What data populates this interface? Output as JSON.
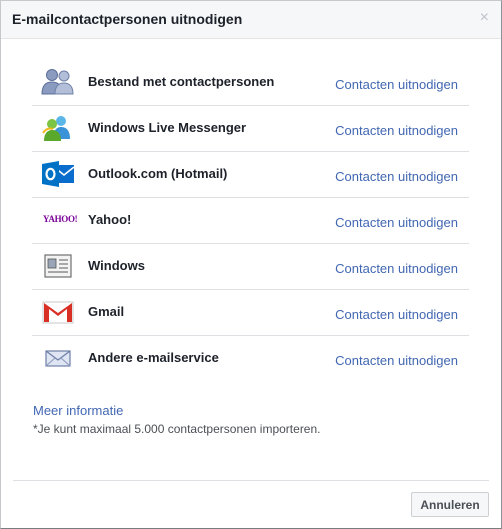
{
  "dialog": {
    "title": "E-mailcontactpersonen uitnodigen",
    "close_glyph": "×"
  },
  "providers": [
    {
      "name": "Bestand met contactpersonen",
      "icon": "contacts-file-icon",
      "action": "Contacten uitnodigen"
    },
    {
      "name": "Windows Live Messenger",
      "icon": "windows-live-messenger-icon",
      "action": "Contacten uitnodigen"
    },
    {
      "name": "Outlook.com (Hotmail)",
      "icon": "outlook-icon",
      "action": "Contacten uitnodigen"
    },
    {
      "name": "Yahoo!",
      "icon": "yahoo-icon",
      "logo_text": "YAHOO!",
      "action": "Contacten uitnodigen"
    },
    {
      "name": "Windows",
      "icon": "windows-address-book-icon",
      "action": "Contacten uitnodigen"
    },
    {
      "name": "Gmail",
      "icon": "gmail-icon",
      "action": "Contacten uitnodigen"
    },
    {
      "name": "Andere e-mailservice",
      "icon": "envelope-icon",
      "action": "Contacten uitnodigen"
    }
  ],
  "info": {
    "more_link": "Meer informatie",
    "note": "*Je kunt maximaal 5.000 contactpersonen importeren."
  },
  "footer": {
    "cancel_label": "Annuleren"
  },
  "colors": {
    "link": "#4267b2",
    "header_bg": "#f6f7f9",
    "divider": "#dddfe2"
  }
}
